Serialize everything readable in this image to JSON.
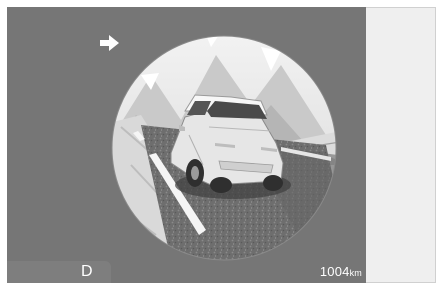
{
  "status": {
    "gear": "D",
    "odometer_value": "1004",
    "odometer_unit": "km"
  },
  "icons": {
    "turn": "right-arrow-icon",
    "vehicle": "car-illustration"
  },
  "colors": {
    "display_bg": "#767676",
    "panel_bg": "#efefef"
  }
}
